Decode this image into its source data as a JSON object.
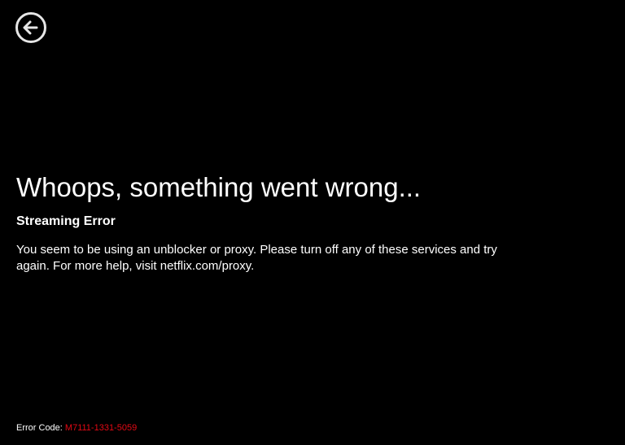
{
  "back_button": {
    "icon": "back-arrow-circle-icon",
    "color": "#e6e6e6"
  },
  "headline": "Whoops, something went wrong...",
  "subtitle": "Streaming Error",
  "message": "You seem to be using an unblocker or proxy. Please turn off any of these services and try again. For more help, visit netflix.com/proxy.",
  "error": {
    "label": "Error Code:",
    "code": "M7111-1331-5059",
    "code_color": "#e50914"
  },
  "colors": {
    "background": "#000000",
    "text": "#ffffff"
  }
}
